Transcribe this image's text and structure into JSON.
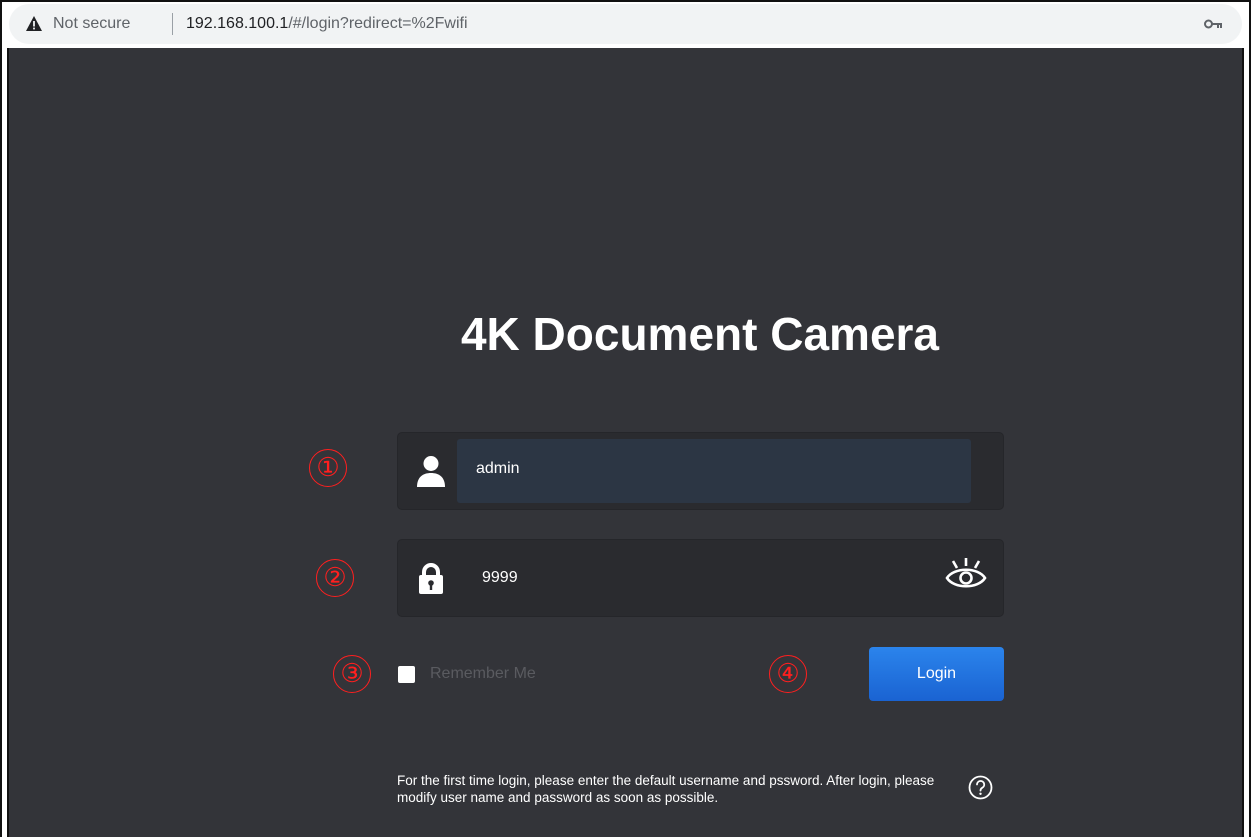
{
  "browser": {
    "security_label": "Not secure",
    "url_host": "192.168.100.1",
    "url_path": "/#/login?redirect=%2Fwifi",
    "icons": {
      "warning": "warning-triangle-icon",
      "key": "key-icon"
    }
  },
  "login": {
    "title": "4K Document Camera",
    "username_value": "admin",
    "password_value": "9999",
    "remember_label": "Remember Me",
    "remember_checked": false,
    "login_button_label": "Login",
    "hint_text": "For the first time login, please enter the default username and pssword. After login, please modify user name and password as soon as possible.",
    "icons": {
      "user": "user-icon",
      "lock": "lock-icon",
      "eye": "eye-icon",
      "help": "help-icon"
    }
  },
  "annotations": [
    "①",
    "②",
    "③",
    "④"
  ],
  "colors": {
    "background": "#333439",
    "field": "#2a2b2f",
    "field_active": "#2c3644",
    "button": "#1f6fe0",
    "annotation": "#ff1f1f"
  }
}
